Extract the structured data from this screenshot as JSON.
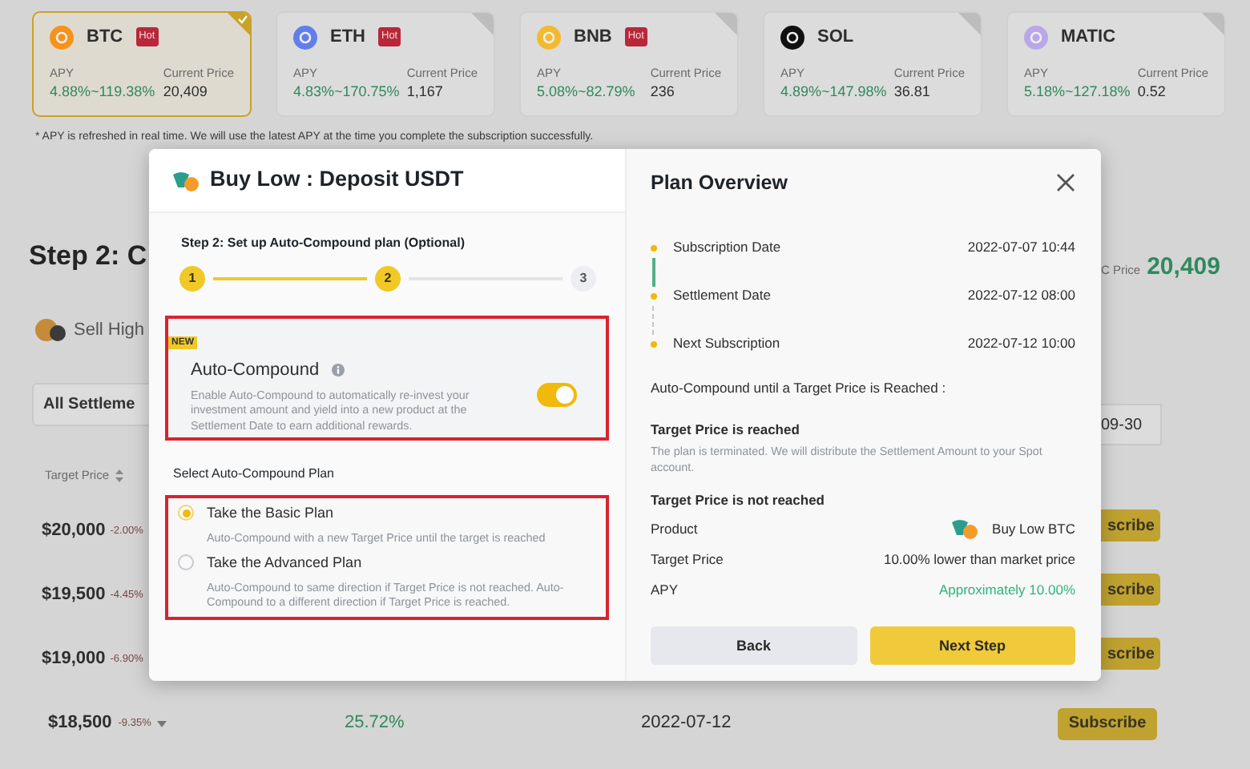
{
  "coins": [
    {
      "symbol": "BTC",
      "badge": "Hot",
      "selected": true,
      "color": "#f7931a",
      "apy_label": "APY",
      "apy": "4.88%~119.38%",
      "price_label": "Current Price",
      "price": "20,409"
    },
    {
      "symbol": "ETH",
      "badge": "Hot",
      "selected": false,
      "color": "#627eea",
      "apy_label": "APY",
      "apy": "4.83%~170.75%",
      "price_label": "Current Price",
      "price": "1,167"
    },
    {
      "symbol": "BNB",
      "badge": "Hot",
      "selected": false,
      "color": "#f3ba2f",
      "apy_label": "APY",
      "apy": "5.08%~82.79%",
      "price_label": "Current Price",
      "price": "236"
    },
    {
      "symbol": "SOL",
      "selected": false,
      "color": "#111111",
      "apy_label": "APY",
      "apy": "4.89%~147.98%",
      "price_label": "Current Price",
      "price": "36.81"
    },
    {
      "symbol": "MATIC",
      "selected": false,
      "color": "#b9a7e8",
      "apy_label": "APY",
      "apy": "5.18%~127.18%",
      "price_label": "Current Price",
      "price": "0.52"
    }
  ],
  "note": "* APY is refreshed in real time. We will use the latest APY at the time you complete the subscription successfully.",
  "page": {
    "heading": "Step 2: C",
    "tab": "Sell High",
    "filter": "All Settleme",
    "price_label": "C Price",
    "price": "20,409",
    "date_filter": "09-30",
    "column": "Target Price",
    "rows": [
      {
        "price": "$20,000",
        "change": "-2.00%",
        "button": "scribe"
      },
      {
        "price": "$19,500",
        "change": "-4.45%",
        "button": "scribe"
      },
      {
        "price": "$19,000",
        "change": "-6.90%",
        "button": "scribe"
      }
    ],
    "last_row": {
      "price": "$18,500",
      "change": "-9.35%",
      "apy": "25.72%",
      "date": "2022-07-12",
      "button": "Subscribe"
    }
  },
  "modal": {
    "title": "Buy Low : Deposit USDT",
    "step_title": "Step 2: Set up Auto-Compound plan (Optional)",
    "steps": [
      {
        "label": "1",
        "reached": true
      },
      {
        "label": "2",
        "reached": true
      },
      {
        "label": "3",
        "reached": false
      }
    ],
    "auto_compound": {
      "badge": "NEW",
      "title": "Auto-Compound",
      "description": "Enable Auto-Compound to automatically re-invest your investment amount and yield into a new product at the Settlement Date to earn additional rewards.",
      "on": true
    },
    "plan_heading": "Select Auto-Compound Plan",
    "plans": [
      {
        "title": "Take the Basic Plan",
        "description": "Auto-Compound with a new Target Price until the target is reached",
        "selected": true
      },
      {
        "title": "Take the Advanced Plan",
        "description": "Auto-Compound to same direction if Target Price is not reached. Auto-Compound to a different direction if Target Price is reached.",
        "selected": false
      }
    ],
    "overview": {
      "title": "Plan Overview",
      "timeline": [
        {
          "label": "Subscription Date",
          "value": "2022-07-07 10:44",
          "done": true
        },
        {
          "label": "Settlement Date",
          "value": "2022-07-12 08:00",
          "done": false
        },
        {
          "label": "Next Subscription",
          "value": "2022-07-12 10:00",
          "done": false
        }
      ],
      "condition": "Auto-Compound until a Target Price is Reached :",
      "reached_title": "Target Price is reached",
      "reached_text": "The plan is terminated. We will distribute the Settlement Amount to your Spot account.",
      "not_reached_title": "Target Price is not reached",
      "details": [
        {
          "kind": "product",
          "label": "Product",
          "value": "Buy Low BTC"
        },
        {
          "kind": "plain",
          "label": "Target Price",
          "value": "10.00% lower than market price"
        },
        {
          "kind": "positive",
          "label": "APY",
          "value": "Approximately 10.00%"
        }
      ]
    },
    "buttons": [
      {
        "kind": "secondary",
        "label": "Back"
      },
      {
        "kind": "primary",
        "label": "Next Step"
      }
    ]
  }
}
